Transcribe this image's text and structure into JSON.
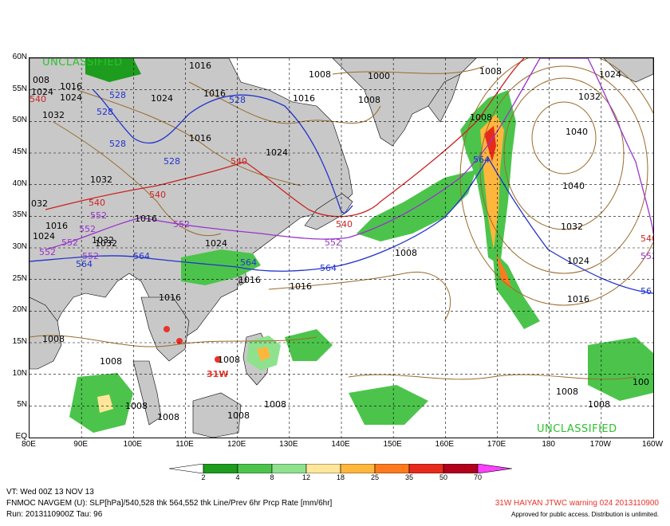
{
  "classification": "UNCLASSIFIED",
  "lat_labels": [
    "60N",
    "55N",
    "50N",
    "45N",
    "40N",
    "35N",
    "30N",
    "25N",
    "20N",
    "15N",
    "10N",
    "5N",
    "EQ"
  ],
  "lon_labels": [
    "80E",
    "90E",
    "100E",
    "110E",
    "120E",
    "130E",
    "140E",
    "150E",
    "160E",
    "170E",
    "180",
    "170W",
    "160W"
  ],
  "colorbar": {
    "ticks": [
      "2",
      "4",
      "8",
      "12",
      "18",
      "25",
      "35",
      "50",
      "70"
    ],
    "colors": [
      "#1d9c1d",
      "#4cc44c",
      "#8ee28e",
      "#ffe69a",
      "#ffb63c",
      "#ff7a1c",
      "#e82a1c",
      "#b0001c",
      "#ff40ff"
    ]
  },
  "colors": {
    "land": "#c8c8c8",
    "slp": "#9a6a2a",
    "thk528": "#2233cc",
    "thk540": "#cc2222",
    "thk552": "#9933cc",
    "thk564": "#2233cc",
    "typhoon": "#e8332a"
  },
  "slp_labels": [
    "008",
    "1016",
    "1024",
    "1016",
    "1032",
    "1016",
    "1024",
    "1016",
    "1008",
    "1016",
    "1000",
    "1008",
    "1008",
    "1008",
    "1024",
    "1032",
    "1040",
    "1040",
    "1032",
    "1024",
    "1016",
    "1032",
    "1024",
    "1016",
    "1016",
    "1016",
    "1016",
    "1032",
    "1024",
    "1016",
    "1008",
    "1008",
    "1008",
    "1008",
    "1008",
    "1008",
    "1008",
    "1008",
    "1008",
    "1008",
    "100",
    "1024",
    "1032",
    "032",
    "1024"
  ],
  "thickness_labels": {
    "528": [
      "528",
      "528",
      "528",
      "528",
      "528"
    ],
    "540": [
      "540",
      "540",
      "540",
      "540",
      "540",
      "540"
    ],
    "552": [
      "552",
      "552",
      "552",
      "552",
      "552",
      "552",
      "552",
      "552"
    ],
    "564": [
      "564",
      "564",
      "564",
      "564",
      "564",
      "56"
    ]
  },
  "typhoon_label": "31W",
  "footer": {
    "vt": "VT: Wed 00Z 13 NOV 13",
    "model": "FNMOC NAVGEM (U): SLP[hPa]/540,528 thk 564,552 thk Line/Prev 6hr Prcp Rate [mm/6hr]",
    "run": "Run: 2013110900Z Tau: 96",
    "warning": "31W HAIYAN JTWC warning 024 2013110900",
    "approved": "Approved for public access. Distribution is unlimited."
  }
}
